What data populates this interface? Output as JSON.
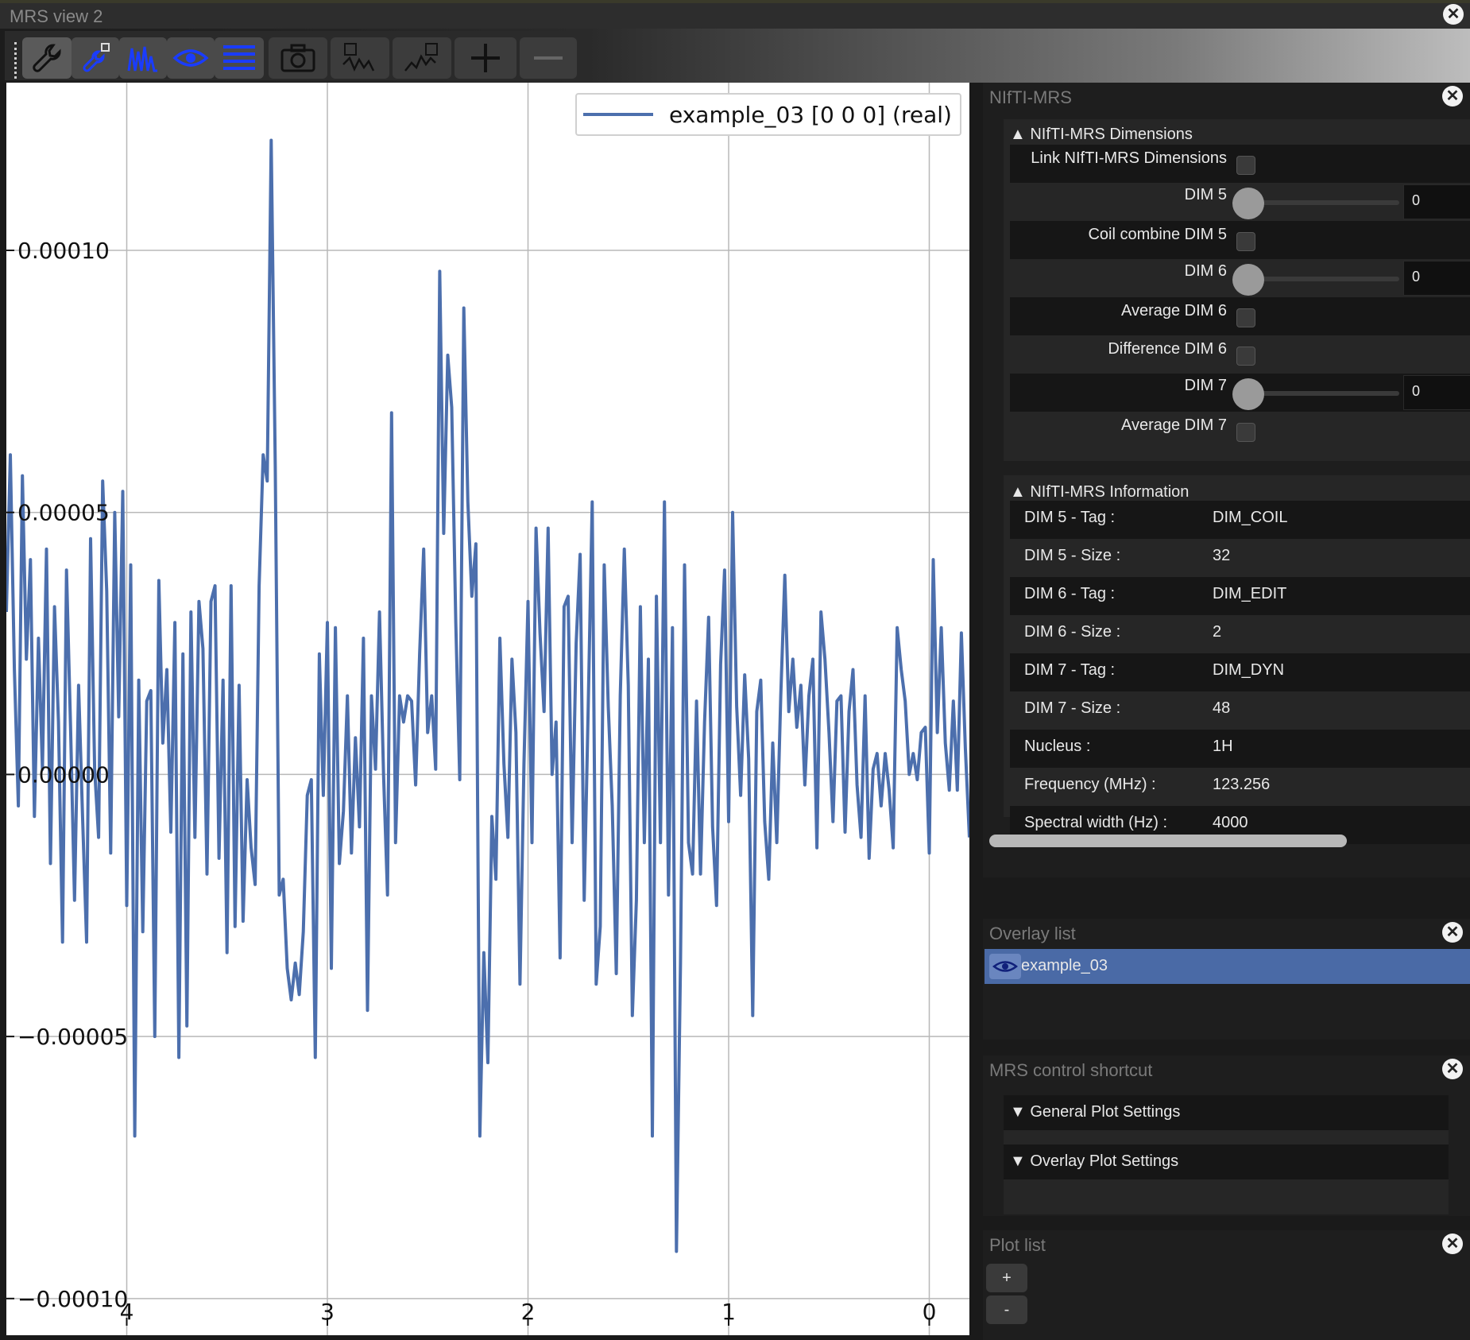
{
  "window": {
    "title": "MRS view 2"
  },
  "toolbar": {
    "buttons": [
      {
        "name": "settings-wrench"
      },
      {
        "name": "link-settings"
      },
      {
        "name": "spectrum-view"
      },
      {
        "name": "eye-overlay"
      },
      {
        "name": "list-view"
      },
      {
        "name": "screenshot"
      },
      {
        "name": "plot-data"
      },
      {
        "name": "plot-add"
      },
      {
        "name": "zoom-in"
      },
      {
        "name": "zoom-out"
      }
    ]
  },
  "chart_data": {
    "type": "line",
    "title": "",
    "xlabel": "",
    "ylabel": "",
    "xlim": [
      4.6,
      -0.2
    ],
    "ylim": [
      -0.000107,
      0.000132
    ],
    "xticks": [
      "4",
      "3",
      "2",
      "1",
      "0"
    ],
    "xtick_values": [
      4,
      3,
      2,
      1,
      0
    ],
    "yticks": [
      "0.00010",
      "0.00005",
      "0.00000",
      "−0.00005",
      "−0.00010"
    ],
    "ytick_values": [
      0.0001,
      5e-05,
      0,
      -5e-05,
      -0.0001
    ],
    "grid": true,
    "legend_position": "top-right",
    "series": [
      {
        "name": "example_03 [0 0 0] (real)",
        "color": "#4c6fad",
        "points": [
          [
            4.6,
            3.1e-05
          ],
          [
            4.58,
            6.1e-05
          ],
          [
            4.56,
            2e-05
          ],
          [
            4.54,
            -6e-06
          ],
          [
            4.52,
            5.7e-05
          ],
          [
            4.5,
            2.2e-05
          ],
          [
            4.48,
            4.1e-05
          ],
          [
            4.46,
            -8e-06
          ],
          [
            4.44,
            2.6e-05
          ],
          [
            4.42,
            1e-06
          ],
          [
            4.4,
            4.3e-05
          ],
          [
            4.38,
            -1.7e-05
          ],
          [
            4.36,
            3.2e-05
          ],
          [
            4.34,
            1e-05
          ],
          [
            4.32,
            -3.2e-05
          ],
          [
            4.3,
            3.9e-05
          ],
          [
            4.28,
            9e-06
          ],
          [
            4.26,
            -2.4e-05
          ],
          [
            4.24,
            1.7e-05
          ],
          [
            4.22,
            -8e-06
          ],
          [
            4.2,
            -3.2e-05
          ],
          [
            4.18,
            4.5e-05
          ],
          [
            4.16,
            1e-06
          ],
          [
            4.14,
            -1.2e-05
          ],
          [
            4.12,
            5.6e-05
          ],
          [
            4.1,
            3.5e-05
          ],
          [
            4.08,
            -1.5e-05
          ],
          [
            4.06,
            5e-05
          ],
          [
            4.04,
            1.1e-05
          ],
          [
            4.02,
            5.4e-05
          ],
          [
            4.0,
            -2.5e-05
          ],
          [
            3.98,
            4e-05
          ],
          [
            3.96,
            -6.9e-05
          ],
          [
            3.94,
            1.8e-05
          ],
          [
            3.92,
            -3e-05
          ],
          [
            3.9,
            1.4e-05
          ],
          [
            3.88,
            1.6e-05
          ],
          [
            3.86,
            -5e-05
          ],
          [
            3.84,
            3.7e-05
          ],
          [
            3.82,
            6e-06
          ],
          [
            3.8,
            2e-05
          ],
          [
            3.78,
            -1.1e-05
          ],
          [
            3.76,
            2.9e-05
          ],
          [
            3.74,
            -5.4e-05
          ],
          [
            3.72,
            2.3e-05
          ],
          [
            3.7,
            -4.8e-05
          ],
          [
            3.68,
            3.1e-05
          ],
          [
            3.66,
            -1.2e-05
          ],
          [
            3.64,
            3.3e-05
          ],
          [
            3.62,
            2.4e-05
          ],
          [
            3.6,
            -1.9e-05
          ],
          [
            3.58,
            3.3e-05
          ],
          [
            3.56,
            3.6e-05
          ],
          [
            3.54,
            -1.6e-05
          ],
          [
            3.52,
            1.8e-05
          ],
          [
            3.5,
            -3.4e-05
          ],
          [
            3.48,
            3.6e-05
          ],
          [
            3.46,
            -2.9e-05
          ],
          [
            3.44,
            1.7e-05
          ],
          [
            3.42,
            -2.8e-05
          ],
          [
            3.4,
            -1e-06
          ],
          [
            3.38,
            -1.4e-05
          ],
          [
            3.36,
            -2.1e-05
          ],
          [
            3.34,
            3.6e-05
          ],
          [
            3.32,
            6.1e-05
          ],
          [
            3.3,
            5.6e-05
          ],
          [
            3.28,
            0.000121
          ],
          [
            3.26,
            5.9e-05
          ],
          [
            3.24,
            -2.3e-05
          ],
          [
            3.22,
            -2e-05
          ],
          [
            3.2,
            -3.7e-05
          ],
          [
            3.18,
            -4.3e-05
          ],
          [
            3.16,
            -3.6e-05
          ],
          [
            3.14,
            -4.2e-05
          ],
          [
            3.12,
            -3e-05
          ],
          [
            3.1,
            -4e-06
          ],
          [
            3.08,
            -1e-06
          ],
          [
            3.06,
            -5.4e-05
          ],
          [
            3.04,
            2.3e-05
          ],
          [
            3.02,
            -4e-06
          ],
          [
            3.0,
            2.9e-05
          ],
          [
            2.98,
            -3.7e-05
          ],
          [
            2.96,
            2.8e-05
          ],
          [
            2.94,
            -1.7e-05
          ],
          [
            2.92,
            -7e-06
          ],
          [
            2.9,
            1.5e-05
          ],
          [
            2.88,
            -1.5e-05
          ],
          [
            2.86,
            7e-06
          ],
          [
            2.84,
            -1e-05
          ],
          [
            2.82,
            2.6e-05
          ],
          [
            2.8,
            -4.5e-05
          ],
          [
            2.78,
            1.5e-05
          ],
          [
            2.76,
            1e-06
          ],
          [
            2.74,
            3.1e-05
          ],
          [
            2.72,
            0.0
          ],
          [
            2.7,
            -2.3e-05
          ],
          [
            2.68,
            6.9e-05
          ],
          [
            2.66,
            -1.3e-05
          ],
          [
            2.64,
            1.5e-05
          ],
          [
            2.62,
            1e-05
          ],
          [
            2.6,
            1.5e-05
          ],
          [
            2.58,
            1.4e-05
          ],
          [
            2.56,
            -2e-06
          ],
          [
            2.54,
            2.3e-05
          ],
          [
            2.52,
            4.3e-05
          ],
          [
            2.5,
            8e-06
          ],
          [
            2.48,
            1.5e-05
          ],
          [
            2.46,
            1e-06
          ],
          [
            2.44,
            9.6e-05
          ],
          [
            2.42,
            4.6e-05
          ],
          [
            2.4,
            8e-05
          ],
          [
            2.38,
            7e-05
          ],
          [
            2.36,
            2.9e-05
          ],
          [
            2.34,
            -1e-06
          ],
          [
            2.32,
            8.9e-05
          ],
          [
            2.3,
            5.2e-05
          ],
          [
            2.28,
            3.4e-05
          ],
          [
            2.26,
            4.4e-05
          ],
          [
            2.24,
            -6.9e-05
          ],
          [
            2.22,
            -3.4e-05
          ],
          [
            2.2,
            -5.5e-05
          ],
          [
            2.18,
            -8e-06
          ],
          [
            2.16,
            -2e-05
          ],
          [
            2.14,
            2.6e-05
          ],
          [
            2.12,
            2e-06
          ],
          [
            2.1,
            -1.2e-05
          ],
          [
            2.08,
            2.2e-05
          ],
          [
            2.06,
            8e-06
          ],
          [
            2.04,
            -4e-05
          ],
          [
            2.02,
            2e-06
          ],
          [
            2.0,
            3.3e-05
          ],
          [
            1.98,
            -1.3e-05
          ],
          [
            1.96,
            4.7e-05
          ],
          [
            1.94,
            2.7e-05
          ],
          [
            1.92,
            1.2e-05
          ],
          [
            1.9,
            4.7e-05
          ],
          [
            1.88,
            0.0
          ],
          [
            1.86,
            1e-05
          ],
          [
            1.84,
            -3.5e-05
          ],
          [
            1.82,
            3.2e-05
          ],
          [
            1.8,
            3.4e-05
          ],
          [
            1.78,
            -1.3e-05
          ],
          [
            1.76,
            2.5e-05
          ],
          [
            1.74,
            4.2e-05
          ],
          [
            1.72,
            -2.4e-05
          ],
          [
            1.7,
            1.3e-05
          ],
          [
            1.68,
            5.2e-05
          ],
          [
            1.66,
            -4e-05
          ],
          [
            1.64,
            -2.9e-05
          ],
          [
            1.62,
            4e-05
          ],
          [
            1.6,
            1.3e-05
          ],
          [
            1.58,
            -6e-06
          ],
          [
            1.56,
            -3.8e-05
          ],
          [
            1.54,
            1.5e-05
          ],
          [
            1.52,
            4.3e-05
          ],
          [
            1.5,
            1.7e-05
          ],
          [
            1.48,
            -4.6e-05
          ],
          [
            1.46,
            -2.4e-05
          ],
          [
            1.44,
            3.2e-05
          ],
          [
            1.42,
            -1.3e-05
          ],
          [
            1.4,
            2.2e-05
          ],
          [
            1.38,
            -6.9e-05
          ],
          [
            1.36,
            3.4e-05
          ],
          [
            1.34,
            -1.3e-05
          ],
          [
            1.32,
            5.2e-05
          ],
          [
            1.3,
            -2.3e-05
          ],
          [
            1.28,
            2.8e-05
          ],
          [
            1.26,
            -9.1e-05
          ],
          [
            1.24,
            -3.6e-05
          ],
          [
            1.22,
            4e-05
          ],
          [
            1.2,
            -1.3e-05
          ],
          [
            1.18,
            -1.9e-05
          ],
          [
            1.16,
            1.4e-05
          ],
          [
            1.14,
            -1.9e-05
          ],
          [
            1.12,
            1e-05
          ],
          [
            1.1,
            3e-05
          ],
          [
            1.08,
            -1e-05
          ],
          [
            1.06,
            -2.5e-05
          ],
          [
            1.04,
            2.1e-05
          ],
          [
            1.02,
            3.9e-05
          ],
          [
            1.0,
            -9e-06
          ],
          [
            0.98,
            5e-05
          ],
          [
            0.96,
            1.3e-05
          ],
          [
            0.94,
            -4e-06
          ],
          [
            0.92,
            1.9e-05
          ],
          [
            0.9,
            3e-06
          ],
          [
            0.88,
            -4.6e-05
          ],
          [
            0.86,
            1.2e-05
          ],
          [
            0.84,
            1.8e-05
          ],
          [
            0.82,
            -9e-06
          ],
          [
            0.8,
            -2e-05
          ],
          [
            0.78,
            6e-06
          ],
          [
            0.76,
            -1.3e-05
          ],
          [
            0.74,
            1.5e-05
          ],
          [
            0.72,
            3.8e-05
          ],
          [
            0.7,
            1.2e-05
          ],
          [
            0.68,
            2.2e-05
          ],
          [
            0.66,
            9e-06
          ],
          [
            0.64,
            1.7e-05
          ],
          [
            0.62,
            -2e-06
          ],
          [
            0.6,
            1.5e-05
          ],
          [
            0.58,
            2.2e-05
          ],
          [
            0.56,
            -1.4e-05
          ],
          [
            0.54,
            3.1e-05
          ],
          [
            0.52,
            2.2e-05
          ],
          [
            0.5,
            8e-06
          ],
          [
            0.48,
            -9e-06
          ],
          [
            0.46,
            1.4e-05
          ],
          [
            0.44,
            1.5e-05
          ],
          [
            0.42,
            -1.1e-05
          ],
          [
            0.4,
            1.2e-05
          ],
          [
            0.38,
            2e-05
          ],
          [
            0.36,
            -2e-06
          ],
          [
            0.34,
            -1.2e-05
          ],
          [
            0.32,
            1.5e-05
          ],
          [
            0.3,
            -1.6e-05
          ],
          [
            0.28,
            1e-06
          ],
          [
            0.26,
            4e-06
          ],
          [
            0.24,
            -6e-06
          ],
          [
            0.22,
            4e-06
          ],
          [
            0.2,
            -3e-06
          ],
          [
            0.18,
            -1.4e-05
          ],
          [
            0.16,
            2.8e-05
          ],
          [
            0.14,
            2e-05
          ],
          [
            0.12,
            1.4e-05
          ],
          [
            0.1,
            0.0
          ],
          [
            0.08,
            4e-06
          ],
          [
            0.06,
            -1e-06
          ],
          [
            0.04,
            8e-06
          ],
          [
            0.02,
            9e-06
          ],
          [
            0.0,
            -1.5e-05
          ],
          [
            -0.02,
            4.1e-05
          ],
          [
            -0.04,
            8e-06
          ],
          [
            -0.06,
            2.8e-05
          ],
          [
            -0.08,
            6e-06
          ],
          [
            -0.1,
            -3e-06
          ],
          [
            -0.12,
            1.4e-05
          ],
          [
            -0.14,
            -3e-06
          ],
          [
            -0.16,
            2.7e-05
          ],
          [
            -0.18,
            5e-06
          ],
          [
            -0.2,
            -1.2e-05
          ]
        ]
      }
    ]
  },
  "nifti_panel": {
    "title": "NIfTI-MRS",
    "dims_section": "▲ NIfTI-MRS Dimensions",
    "link_label": "Link NIfTI-MRS Dimensions",
    "dim5_label": "DIM 5",
    "dim5_value": "0",
    "coil_combine_label": "Coil combine DIM 5",
    "dim6_label": "DIM 6",
    "dim6_value": "0",
    "average6_label": "Average DIM 6",
    "difference6_label": "Difference DIM 6",
    "dim7_label": "DIM 7",
    "dim7_value": "0",
    "average7_label": "Average DIM 7",
    "info_section": "▲ NIfTI-MRS Information",
    "info": [
      {
        "key": "DIM 5 - Tag :",
        "value": "DIM_COIL"
      },
      {
        "key": "DIM 5 - Size :",
        "value": "32"
      },
      {
        "key": "DIM 6 - Tag :",
        "value": "DIM_EDIT"
      },
      {
        "key": "DIM 6 - Size :",
        "value": "2"
      },
      {
        "key": "DIM 7 - Tag :",
        "value": "DIM_DYN"
      },
      {
        "key": "DIM 7 - Size :",
        "value": "48"
      },
      {
        "key": "Nucleus :",
        "value": "1H"
      },
      {
        "key": "Frequency (MHz) :",
        "value": "123.256"
      },
      {
        "key": "Spectral width (Hz) :",
        "value": "4000"
      }
    ]
  },
  "overlay_panel": {
    "title": "Overlay list",
    "items": [
      {
        "label": "example_03"
      }
    ]
  },
  "control_panel": {
    "title": "MRS control shortcut",
    "general": "▼ General Plot Settings",
    "overlay": "▼ Overlay Plot Settings"
  },
  "plotlist_panel": {
    "title": "Plot list",
    "add_label": "+",
    "remove_label": "-"
  },
  "close_glyph": "✕"
}
